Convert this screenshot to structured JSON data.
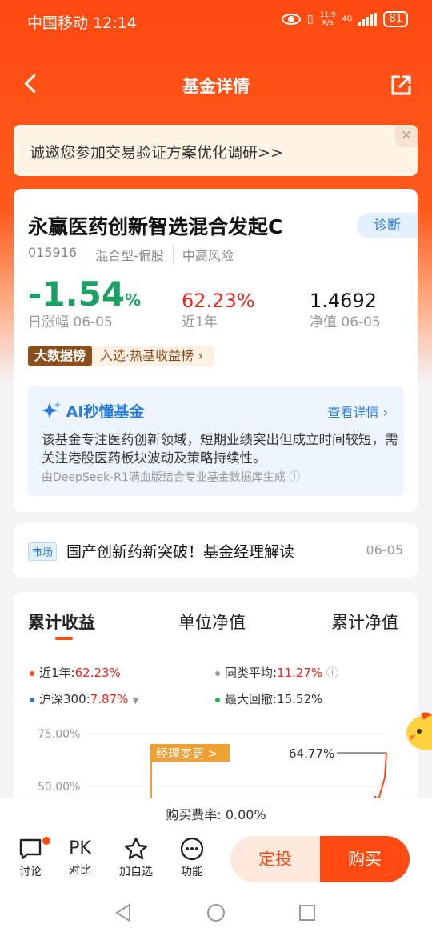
{
  "status": {
    "carrier_time": "中国移动 12:14",
    "net_speed_top": "11.9",
    "net_speed_bottom": "K/s",
    "net_type": "4G",
    "battery": "81"
  },
  "nav": {
    "title": "基金详情"
  },
  "banner": {
    "text": "诚邀您参加交易验证方案优化调研>>"
  },
  "fund": {
    "name": "永赢医药创新智选混合发起C",
    "diagnose_label": "诊断",
    "code": "015916",
    "type": "混合型-偏股",
    "risk": "中高风险",
    "daily_change_value": "-1.54",
    "daily_change_unit": "%",
    "daily_change_label": "日涨幅 06-05",
    "year_return": "62.23%",
    "year_return_label": "近1年",
    "nav_value": "1.4692",
    "nav_label": "净值 06-05",
    "rank_tag_left": "大数据榜",
    "rank_tag_right": "入选·热基收益榜"
  },
  "ai": {
    "title": "AI秒懂基金",
    "link": "查看详情",
    "text": "该基金专注医药创新领域，短期业绩突出但成立时间较短，需关注港股医药板块波动及策略持续性。",
    "source": "由DeepSeek-R1满血版结合专业基金数据库生成"
  },
  "news": {
    "tag": "市场",
    "text": "国产创新药新突破！基金经理解读",
    "date": "06-05"
  },
  "chart_tabs": [
    "累计收益",
    "单位净值",
    "累计净值"
  ],
  "legend": {
    "y1_label": "近1年:",
    "y1_value": "62.23%",
    "peer_label": "同类平均:",
    "peer_value": "11.27%",
    "hs300_label": "沪深300:",
    "hs300_value": "7.87%",
    "drawdown_label": "最大回撤:",
    "drawdown_value": "15.52%"
  },
  "chart_data": {
    "type": "line",
    "y_tick_labels": [
      "75.00%",
      "50.00%"
    ],
    "annotation": "经理变更 >",
    "peak_label": "64.77%",
    "series": [
      {
        "name": "近1年",
        "color": "#ff4a11"
      }
    ]
  },
  "fee": {
    "text": "购买费率: 0.00%"
  },
  "bottom": {
    "discuss": "讨论",
    "compare_icon_text": "PK",
    "compare": "对比",
    "watch": "加自选",
    "features": "功能",
    "sip": "定投",
    "buy": "购买"
  },
  "colors": {
    "brand": "#ff4a11",
    "up": "#e8281e",
    "down": "#1aa163",
    "link": "#2a7bd6"
  }
}
